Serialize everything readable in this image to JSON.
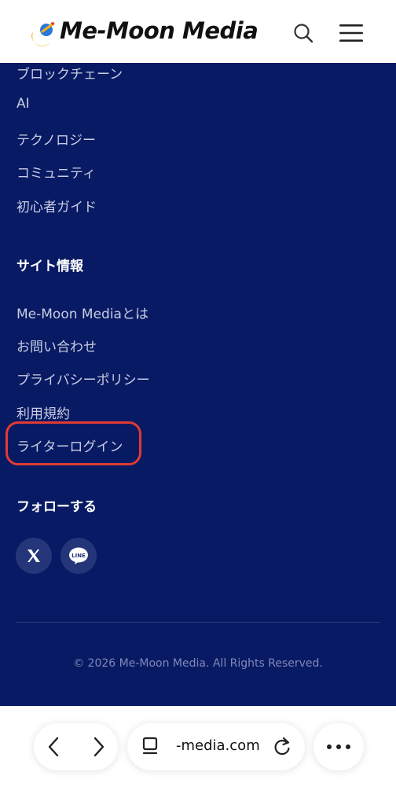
{
  "header": {
    "logo_text": "Me-Moon Media",
    "search_icon": "search-icon",
    "menu_icon": "hamburger-menu-icon"
  },
  "footer": {
    "category_links": [
      "ブロックチェーン",
      "AI",
      "テクノロジー",
      "コミュニティ",
      "初心者ガイド"
    ],
    "site_info": {
      "heading": "サイト情報",
      "links": [
        "Me-Moon Mediaとは",
        "お問い合わせ",
        "プライバシーポリシー",
        "利用規約",
        "ライターログイン"
      ]
    },
    "follow": {
      "heading": "フォローする",
      "icons": [
        "x-icon",
        "line-icon"
      ]
    },
    "copyright": "© 2026 Me-Moon Media. All Rights Reserved."
  },
  "browser": {
    "url": "-media.com",
    "icons": [
      "back-icon",
      "forward-icon",
      "tabs-icon",
      "reload-icon",
      "more-icon"
    ]
  },
  "colors": {
    "panel_bg": "#081a63",
    "highlight": "#e03b32",
    "link": "#c9cde4"
  }
}
